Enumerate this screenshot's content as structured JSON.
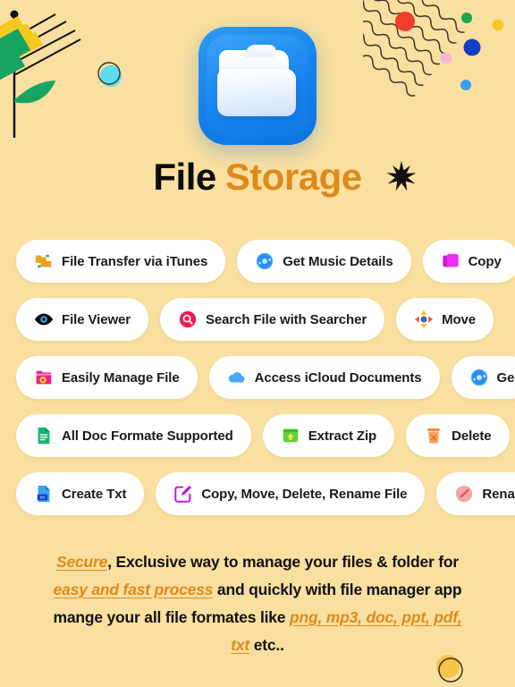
{
  "app": {
    "title_part1": "File",
    "title_part2": "Storage",
    "icon_name": "folder-app-icon"
  },
  "colors": {
    "background": "#FAE0A0",
    "accent_orange": "#DD8A1A",
    "title_black": "#0B0B0B",
    "pill_background": "#FFFFFF",
    "icon_blue": "#1785EE"
  },
  "features": {
    "rows": [
      {
        "items": [
          {
            "label": "File Transfer via iTunes",
            "icon": "folder-transfer-icon"
          },
          {
            "label": "Get Music Details",
            "icon": "music-disc-icon"
          },
          {
            "label": "Copy",
            "icon": "copy-icon"
          }
        ]
      },
      {
        "items": [
          {
            "label": "File Viewer",
            "icon": "eye-icon"
          },
          {
            "label": "Search File with Searcher",
            "icon": "search-icon"
          },
          {
            "label": "Move",
            "icon": "move-arrows-icon"
          }
        ]
      },
      {
        "items": [
          {
            "label": "Easily Manage File",
            "icon": "folder-gear-icon"
          },
          {
            "label": "Access iCloud Documents",
            "icon": "cloud-icon"
          },
          {
            "label": "Ge",
            "icon": "music-disc-icon"
          }
        ]
      },
      {
        "items": [
          {
            "label": "All Doc Formate Supported",
            "icon": "document-icon"
          },
          {
            "label": "Extract Zip",
            "icon": "extract-zip-icon"
          },
          {
            "label": "Delete",
            "icon": "trash-icon"
          }
        ]
      },
      {
        "items": [
          {
            "label": "Create Txt",
            "icon": "txt-file-icon"
          },
          {
            "label": "Copy, Move, Delete, Rename File",
            "icon": "edit-square-icon"
          },
          {
            "label": "Renam",
            "icon": "rename-pencil-icon"
          }
        ]
      }
    ]
  },
  "footer": {
    "seg1_highlight": "Secure",
    "seg2": ", Exclusive way to manage your files & folder for ",
    "seg3_highlight": "easy and fast process",
    "seg4": " and quickly with file manager app mange your all file formates like ",
    "seg5_highlight": "png, mp3, doc, ppt, pdf, txt",
    "seg6": " etc.."
  },
  "decorations": {
    "wheat": "wheat-plant-decoration",
    "waves": "wavy-lines-decoration",
    "cyan_circle": "cyan-circle-decoration",
    "star": "star-burst-decoration",
    "bottom_circle": "yellow-circle-decoration",
    "wave_dots": [
      "#F03E2F",
      "#17A74A",
      "#F7C927",
      "#1240C4",
      "#F6B8D8",
      "#3B9EF5"
    ]
  }
}
